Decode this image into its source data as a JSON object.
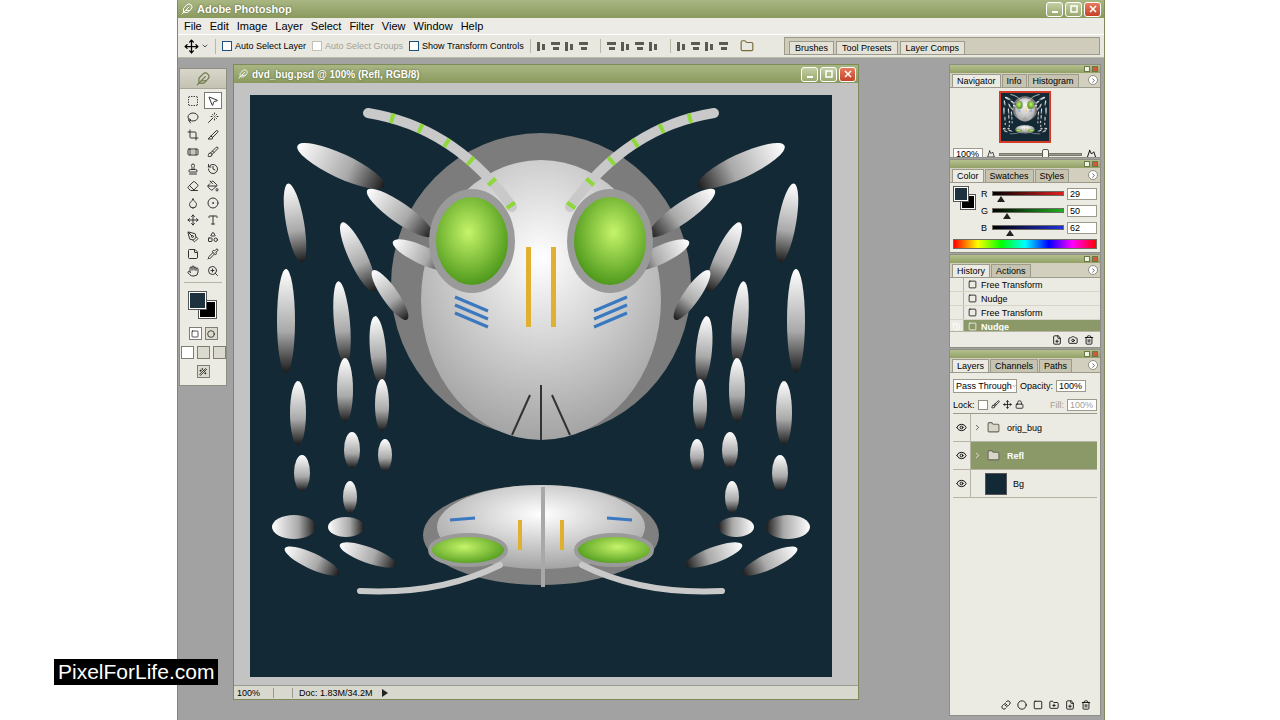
{
  "window": {
    "title": "Adobe Photoshop"
  },
  "menu": [
    "File",
    "Edit",
    "Image",
    "Layer",
    "Select",
    "Filter",
    "View",
    "Window",
    "Help"
  ],
  "options_bar": {
    "checkboxes": [
      {
        "label": "Auto Select Layer",
        "checked": false,
        "disabled": false
      },
      {
        "label": "Auto Select Groups",
        "checked": false,
        "disabled": true
      },
      {
        "label": "Show Transform Controls",
        "checked": false,
        "disabled": false
      }
    ]
  },
  "palette_well": {
    "tabs": [
      "Brushes",
      "Tool Presets",
      "Layer Comps"
    ]
  },
  "toolbox": {
    "foreground_color": "#1d323e",
    "background_color": "#000000"
  },
  "document": {
    "title": "dvd_bug.psd @ 100% (Refl, RGB/8)",
    "zoom": "100%",
    "info": "Doc: 1.83M/34.2M"
  },
  "navigator": {
    "tabs": [
      {
        "label": "Navigator",
        "selected": true
      },
      {
        "label": "Info",
        "selected": false
      },
      {
        "label": "Histogram",
        "selected": false
      }
    ],
    "zoom": "100%",
    "level": 0.55
  },
  "color": {
    "tabs": [
      {
        "label": "Color",
        "selected": true
      },
      {
        "label": "Swatches",
        "selected": false
      },
      {
        "label": "Styles",
        "selected": false
      }
    ],
    "channels": [
      {
        "name": "R",
        "value": "29",
        "level": 0.11,
        "color": "#e02020"
      },
      {
        "name": "G",
        "value": "50",
        "level": 0.2,
        "color": "#20b020"
      },
      {
        "name": "B",
        "value": "62",
        "level": 0.24,
        "color": "#2030e0"
      }
    ]
  },
  "history": {
    "tabs": [
      {
        "label": "History",
        "selected": true
      },
      {
        "label": "Actions",
        "selected": false
      }
    ],
    "items": [
      {
        "label": "Free Transform",
        "selected": false
      },
      {
        "label": "Nudge",
        "selected": false
      },
      {
        "label": "Free Transform",
        "selected": false
      },
      {
        "label": "Nudge",
        "selected": true
      }
    ]
  },
  "layers": {
    "tabs": [
      {
        "label": "Layers",
        "selected": true
      },
      {
        "label": "Channels",
        "selected": false
      },
      {
        "label": "Paths",
        "selected": false
      }
    ],
    "blend_mode": "Pass Through",
    "opacity_label": "Opacity:",
    "opacity": "100%",
    "lock_label": "Lock:",
    "fill_label": "Fill:",
    "fill": "100%",
    "fill_disabled": true,
    "items": [
      {
        "name": "orig_bug",
        "kind": "group",
        "visible": true,
        "expanded": false,
        "selected": false
      },
      {
        "name": "Refl",
        "kind": "group",
        "visible": true,
        "expanded": false,
        "selected": true
      },
      {
        "name": "Bg",
        "kind": "layer",
        "visible": true,
        "expanded": false,
        "selected": false
      }
    ]
  },
  "watermark": "PixelForLife.com"
}
